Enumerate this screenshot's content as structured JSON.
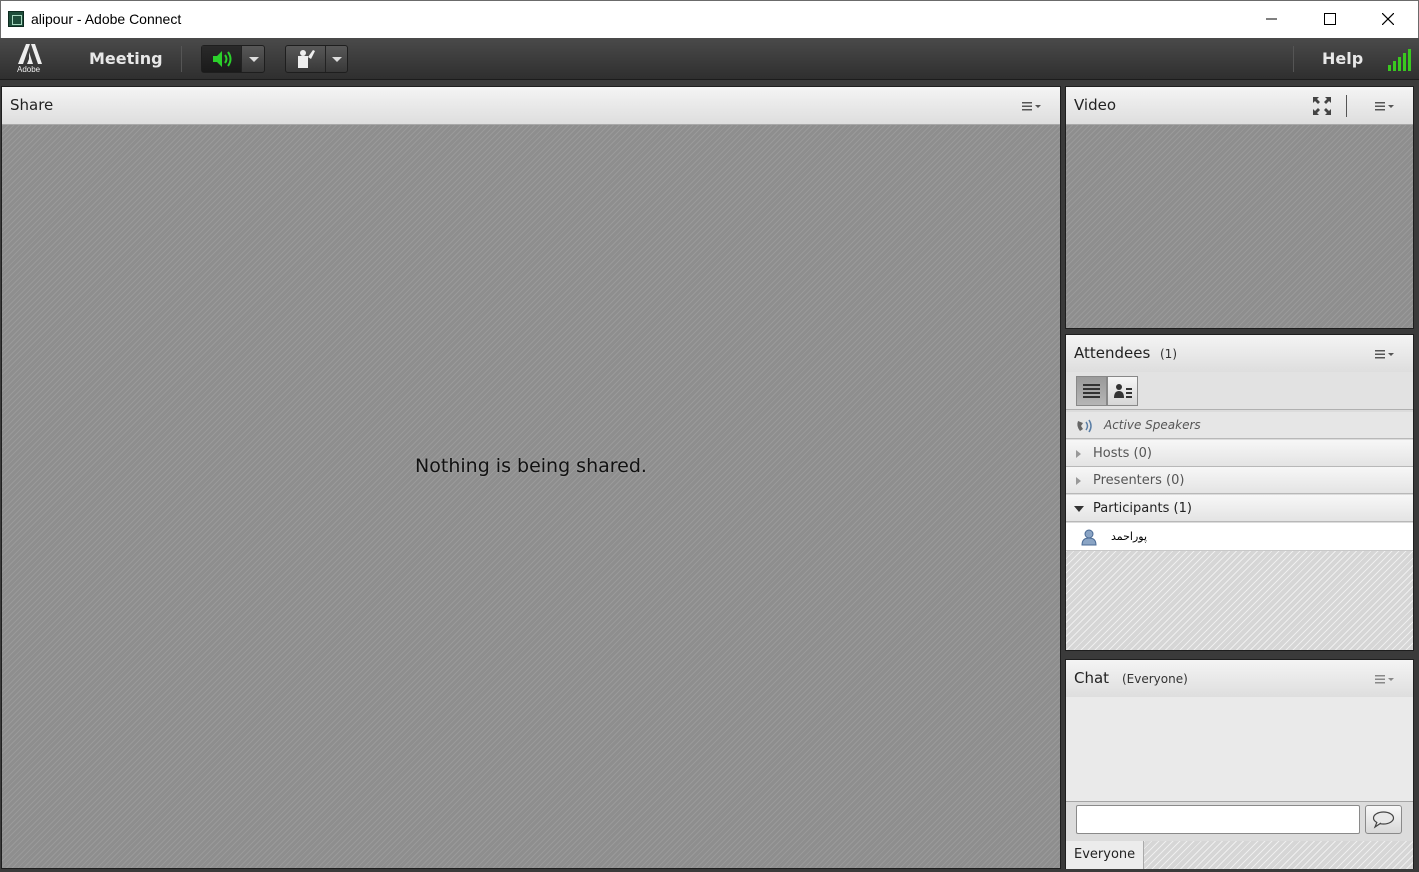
{
  "window": {
    "title": "alipour - Adobe Connect"
  },
  "menubar": {
    "logo_text": "Adobe",
    "meeting_label": "Meeting",
    "help_label": "Help"
  },
  "share": {
    "title": "Share",
    "message": "Nothing is being shared."
  },
  "video": {
    "title": "Video"
  },
  "attendees": {
    "title": "Attendees",
    "count": "(1)",
    "active_speakers": "Active Speakers",
    "groups": [
      {
        "label": "Hosts (0)",
        "expanded": false
      },
      {
        "label": "Presenters (0)",
        "expanded": false
      },
      {
        "label": "Participants (1)",
        "expanded": true
      }
    ],
    "participants": [
      {
        "name": "پوراحمد"
      }
    ]
  },
  "chat": {
    "title": "Chat",
    "scope": "(Everyone)",
    "input_value": "",
    "tab_label": "Everyone"
  },
  "colors": {
    "speaker_active": "#2bd12b",
    "signal": "#39c81f",
    "panel_bg": "#dcdcdc"
  }
}
